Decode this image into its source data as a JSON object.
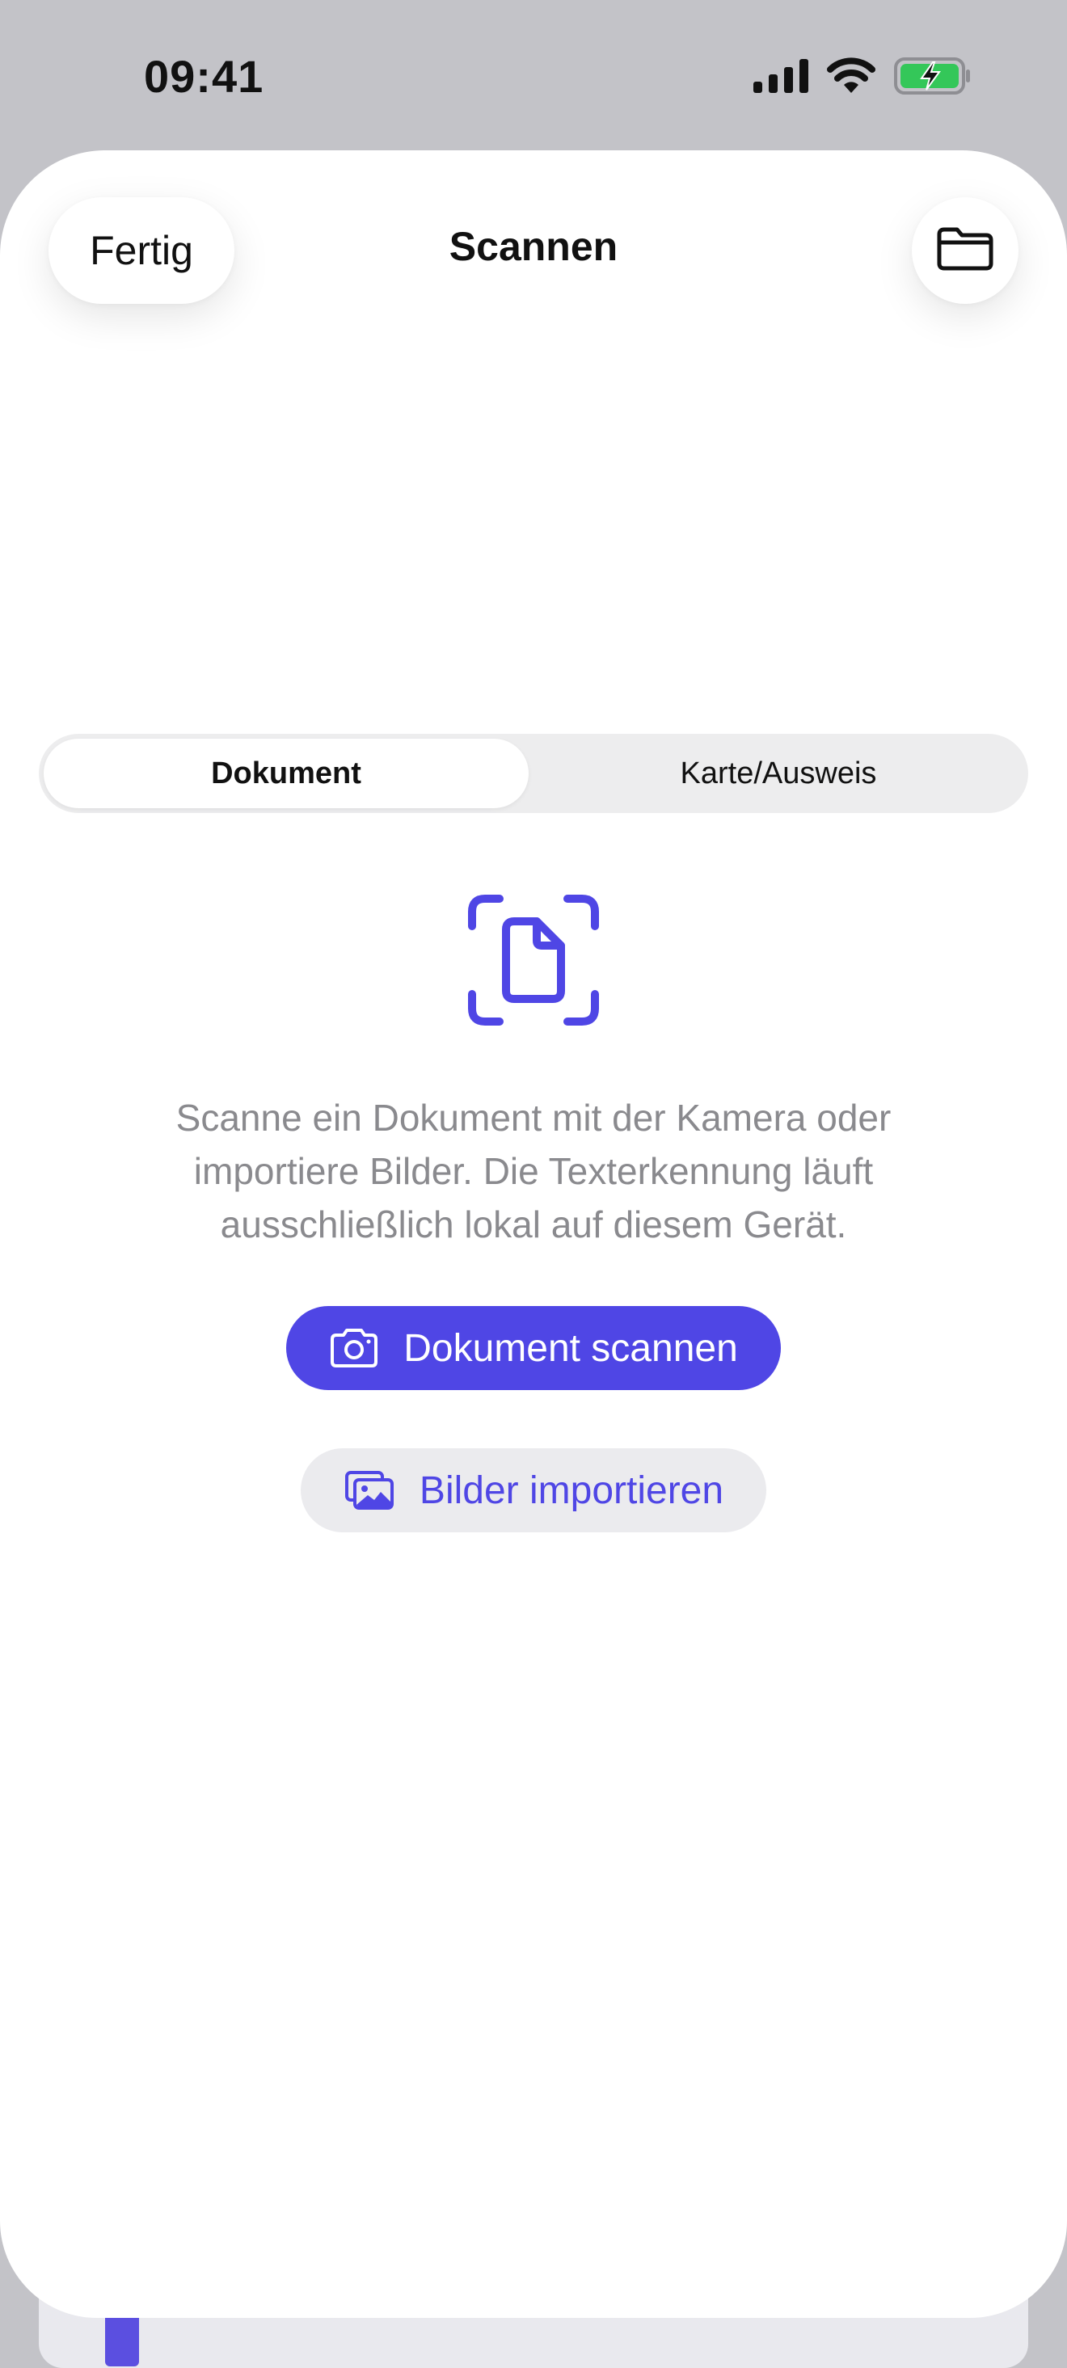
{
  "status_bar": {
    "time": "09:41",
    "icons": [
      "cellular-signal-icon",
      "wifi-icon",
      "battery-charging-icon"
    ],
    "battery_color": "#34c759"
  },
  "header": {
    "done_label": "Fertig",
    "title": "Scannen",
    "folder_icon": "folder-icon"
  },
  "segmented_control": {
    "options": [
      "Dokument",
      "Karte/Ausweis"
    ],
    "selected": "Dokument"
  },
  "content": {
    "icon": "document-scan-icon",
    "description": "Scanne ein Dokument mit der Kamera oder importiere Bilder. Die Texterkennung läuft ausschließlich lokal auf diesem Gerät.",
    "scan_button_label": "Dokument scannen",
    "scan_button_icon": "camera-icon",
    "import_button_label": "Bilder importieren",
    "import_button_icon": "photos-icon"
  },
  "colors": {
    "accent": "#4f46e5",
    "secondary_button_bg": "#ebebee",
    "description_text": "#8a8a8e",
    "backdrop": "#c3c3c8"
  }
}
